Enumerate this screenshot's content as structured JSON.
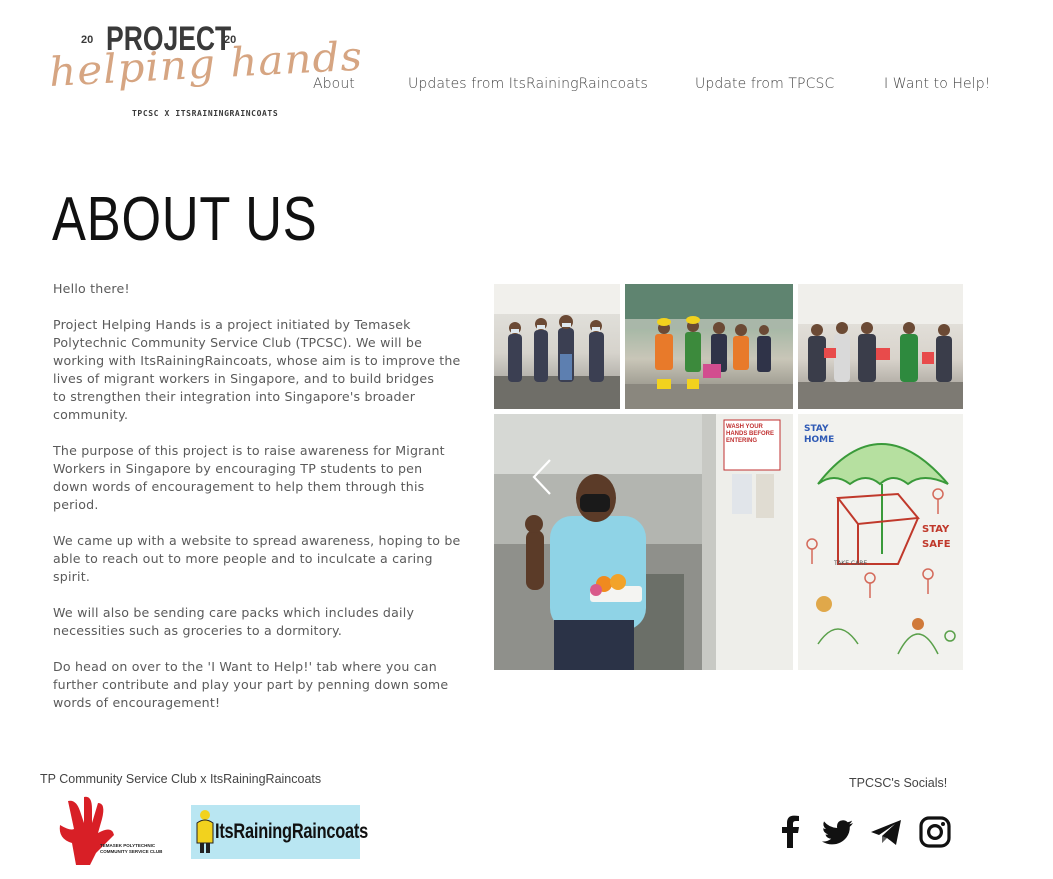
{
  "logo": {
    "year_left": "20",
    "year_right": "20",
    "title": "PROJECT",
    "script": "helping hands",
    "subtitle": "TPCSC X ITSRAININGRAINCOATS"
  },
  "nav": {
    "items": [
      {
        "label": "About"
      },
      {
        "label": "Updates from ItsRainingRaincoats"
      },
      {
        "label": "Update from TPCSC"
      },
      {
        "label": "I Want to Help!"
      }
    ]
  },
  "main": {
    "title": "ABOUT US",
    "paragraphs": [
      "Hello there!",
      "Project Helping Hands is a project initiated by Temasek\nPolytechnic Community Service Club (TPCSC). We will be\nworking with ItsRainingRaincoats, whose aim is to improve the\nlives of migrant workers in Singapore, and to build bridges\nto strengthen their integration into Singapore's broader\ncommunity.",
      "The purpose of this project is to raise awareness for Migrant\nWorkers in Singapore by encouraging TP students to pen\ndown words of encouragement to help them through this period.",
      "We came up with a website to spread awareness, hoping to be\nable to reach out to more people and to inculcate a caring spirit.",
      "We will also be sending care packs which includes daily\nnecessities such as groceries to a dormitory.",
      "Do head on over to the 'I Want to Help!' tab where you can\nfurther contribute and play your part by penning down some\nwords of encouragement!"
    ]
  },
  "gallery": {
    "sign_text": "WASH YOUR HANDS BEFORE ENTERING",
    "drawing_text": {
      "stay_home": "STAY HOME",
      "stay_safe": "STAY SAFE",
      "take_care": "TAKE CARE"
    }
  },
  "footer": {
    "left_title": "TP Community Service Club x ItsRainingRaincoats",
    "tp_logo_text": "TEMASEK POLYTECHNIC\nCOMMUNITY SERVICE CLUB",
    "irr_logo_text": "ItsRainingRaincoats",
    "socials_title": "TPCSC's Socials!",
    "socials": [
      "facebook-icon",
      "twitter-icon",
      "telegram-icon",
      "instagram-icon"
    ]
  },
  "colors": {
    "logo_script": "#d6a582",
    "tp_red": "#d81f26",
    "irr_bg": "#b9e6f2",
    "text": "#5a5a5a"
  }
}
